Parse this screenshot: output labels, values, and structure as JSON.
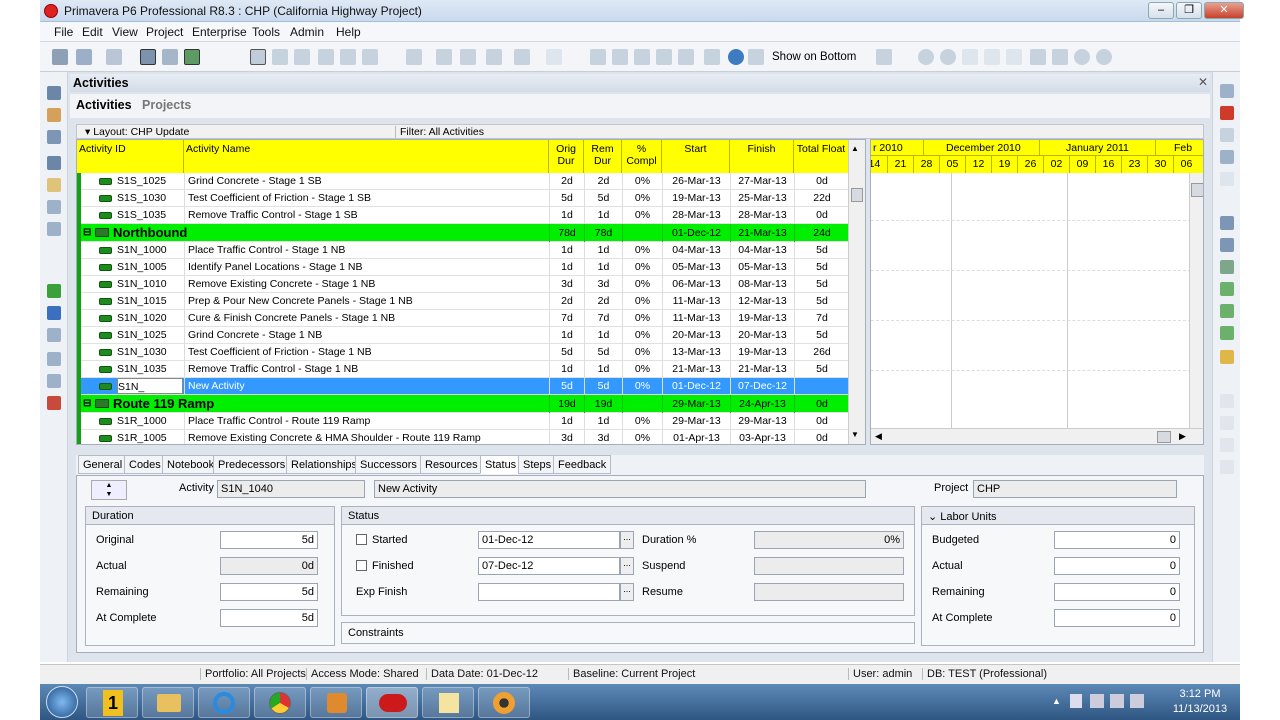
{
  "window": {
    "title": "Primavera P6 Professional R8.3 : CHP (California Highway Project)"
  },
  "menu": [
    "File",
    "Edit",
    "View",
    "Project",
    "Enterprise",
    "Tools",
    "Admin",
    "Help"
  ],
  "toolbar": {
    "show_on_bottom": "Show on Bottom"
  },
  "panel": {
    "title": "Activities",
    "tabs": [
      "Activities",
      "Projects"
    ]
  },
  "layout": {
    "layout_label": "Layout: CHP Update",
    "filter_label": "Filter: All Activities"
  },
  "columns": {
    "id": "Activity ID",
    "name": "Activity Name",
    "orig_dur_1": "Orig",
    "orig_dur_2": "Dur",
    "rem_dur_1": "Rem",
    "rem_dur_2": "Dur",
    "pct_1": "%",
    "pct_2": "Compl",
    "start": "Start",
    "finish": "Finish",
    "total_float": "Total Float"
  },
  "rows": [
    {
      "type": "act",
      "id": "S1S_1025",
      "name": "Grind Concrete - Stage 1 SB",
      "od": "2d",
      "rd": "2d",
      "pct": "0%",
      "start": "26-Mar-13",
      "finish": "27-Mar-13",
      "tf": "0d"
    },
    {
      "type": "act",
      "id": "S1S_1030",
      "name": "Test Coefficient of Friction - Stage 1 SB",
      "od": "5d",
      "rd": "5d",
      "pct": "0%",
      "start": "19-Mar-13",
      "finish": "25-Mar-13",
      "tf": "22d"
    },
    {
      "type": "act",
      "id": "S1S_1035",
      "name": "Remove Traffic Control - Stage 1 SB",
      "od": "1d",
      "rd": "1d",
      "pct": "0%",
      "start": "28-Mar-13",
      "finish": "28-Mar-13",
      "tf": "0d"
    },
    {
      "type": "wbs",
      "id": "Northbound",
      "od": "78d",
      "rd": "78d",
      "pct": "",
      "start": "01-Dec-12",
      "finish": "21-Mar-13",
      "tf": "24d"
    },
    {
      "type": "act",
      "id": "S1N_1000",
      "name": "Place Traffic Control - Stage 1 NB",
      "od": "1d",
      "rd": "1d",
      "pct": "0%",
      "start": "04-Mar-13",
      "finish": "04-Mar-13",
      "tf": "5d"
    },
    {
      "type": "act",
      "id": "S1N_1005",
      "name": "Identify Panel Locations - Stage 1 NB",
      "od": "1d",
      "rd": "1d",
      "pct": "0%",
      "start": "05-Mar-13",
      "finish": "05-Mar-13",
      "tf": "5d"
    },
    {
      "type": "act",
      "id": "S1N_1010",
      "name": "Remove Existing Concrete - Stage 1 NB",
      "od": "3d",
      "rd": "3d",
      "pct": "0%",
      "start": "06-Mar-13",
      "finish": "08-Mar-13",
      "tf": "5d"
    },
    {
      "type": "act",
      "id": "S1N_1015",
      "name": "Prep & Pour New Concrete Panels - Stage 1 NB",
      "od": "2d",
      "rd": "2d",
      "pct": "0%",
      "start": "11-Mar-13",
      "finish": "12-Mar-13",
      "tf": "5d"
    },
    {
      "type": "act",
      "id": "S1N_1020",
      "name": "Cure & Finish Concrete Panels - Stage 1 NB",
      "od": "7d",
      "rd": "7d",
      "pct": "0%",
      "start": "11-Mar-13",
      "finish": "19-Mar-13",
      "tf": "7d"
    },
    {
      "type": "act",
      "id": "S1N_1025",
      "name": "Grind Concrete - Stage 1 NB",
      "od": "1d",
      "rd": "1d",
      "pct": "0%",
      "start": "20-Mar-13",
      "finish": "20-Mar-13",
      "tf": "5d"
    },
    {
      "type": "act",
      "id": "S1N_1030",
      "name": "Test Coefficient of Friction - Stage 1 NB",
      "od": "5d",
      "rd": "5d",
      "pct": "0%",
      "start": "13-Mar-13",
      "finish": "19-Mar-13",
      "tf": "26d"
    },
    {
      "type": "act",
      "id": "S1N_1035",
      "name": "Remove Traffic Control - Stage 1 NB",
      "od": "1d",
      "rd": "1d",
      "pct": "0%",
      "start": "21-Mar-13",
      "finish": "21-Mar-13",
      "tf": "5d"
    },
    {
      "type": "sel",
      "id": "S1N_",
      "name": "New Activity",
      "od": "5d",
      "rd": "5d",
      "pct": "0%",
      "start": "01-Dec-12",
      "finish": "07-Dec-12",
      "tf": ""
    },
    {
      "type": "wbs",
      "id": "Route 119 Ramp",
      "od": "19d",
      "rd": "19d",
      "pct": "",
      "start": "29-Mar-13",
      "finish": "24-Apr-13",
      "tf": "0d"
    },
    {
      "type": "act",
      "id": "S1R_1000",
      "name": "Place Traffic Control - Route 119 Ramp",
      "od": "1d",
      "rd": "1d",
      "pct": "0%",
      "start": "29-Mar-13",
      "finish": "29-Mar-13",
      "tf": "0d"
    },
    {
      "type": "act",
      "id": "S1R_1005",
      "name": "Remove Existing Concrete & HMA Shoulder - Route 119 Ramp",
      "od": "3d",
      "rd": "3d",
      "pct": "0%",
      "start": "01-Apr-13",
      "finish": "03-Apr-13",
      "tf": "0d"
    }
  ],
  "gantt": {
    "months": [
      "r 2010",
      "December 2010",
      "January 2011",
      "Feb"
    ],
    "days": [
      "14",
      "21",
      "28",
      "05",
      "12",
      "19",
      "26",
      "02",
      "09",
      "16",
      "23",
      "30",
      "06"
    ]
  },
  "detail_tabs": [
    "General",
    "Codes",
    "Notebook",
    "Predecessors",
    "Relationships",
    "Successors",
    "Resources",
    "Status",
    "Steps",
    "Feedback"
  ],
  "detail": {
    "activity_label": "Activity",
    "activity_id": "S1N_1040",
    "activity_name": "New Activity",
    "project_label": "Project",
    "project_value": "CHP",
    "duration": {
      "title": "Duration",
      "original_label": "Original",
      "original": "5d",
      "actual_label": "Actual",
      "actual": "0d",
      "remaining_label": "Remaining",
      "remaining": "5d",
      "at_complete_label": "At Complete",
      "at_complete": "5d"
    },
    "status": {
      "title": "Status",
      "started_label": "Started",
      "started": "01-Dec-12",
      "finished_label": "Finished",
      "finished": "07-Dec-12",
      "exp_finish_label": "Exp Finish",
      "duration_pct_label": "Duration %",
      "duration_pct": "0%",
      "suspend_label": "Suspend",
      "resume_label": "Resume",
      "constraints": "Constraints"
    },
    "labor": {
      "title": "Labor Units",
      "budgeted_label": "Budgeted",
      "budgeted": "0",
      "actual_label": "Actual",
      "actual": "0",
      "remaining_label": "Remaining",
      "remaining": "0",
      "at_complete_label": "At Complete",
      "at_complete": "0"
    }
  },
  "statusbar": {
    "portfolio": "Portfolio: All Projects",
    "access": "Access Mode: Shared",
    "data_date": "Data Date: 01-Dec-12",
    "baseline": "Baseline: Current Project",
    "user": "User: admin",
    "db": "DB: TEST (Professional)"
  },
  "taskbar": {
    "time": "3:12 PM",
    "date": "11/13/2013"
  },
  "colors": {
    "header_yellow": "#ffff00",
    "wbs_green": "#00ee00",
    "selection_blue": "#3399ff"
  }
}
